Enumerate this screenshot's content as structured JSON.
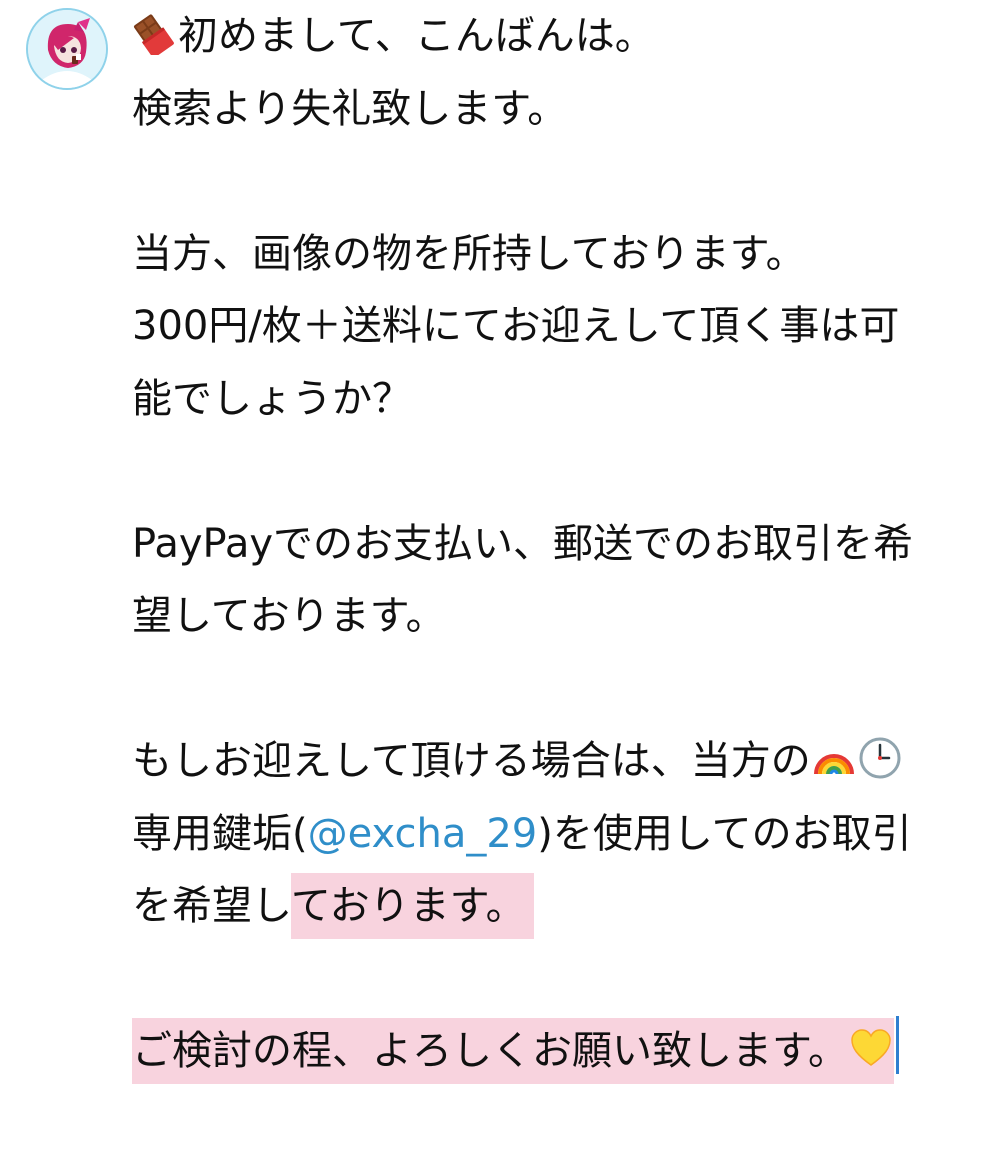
{
  "avatar": {
    "icon": "user-avatar-icon"
  },
  "message": {
    "line1_emoji": "chocolate-bar-icon",
    "line1_text": "初めまして、こんばんは。",
    "line2": "検索より失礼致します。",
    "line3": "当方、画像の物を所持しております。",
    "line4": "300円/枚＋送料にてお迎えして頂く事は可",
    "line5": "能でしょうか？",
    "line6": "PayPayでのお支払い、郵送でのお取引を希",
    "line7": "望しております。",
    "line8_text": "もしお迎えして頂ける場合は、当方の",
    "line8_emoji1": "rainbow-icon",
    "line8_emoji2": "clock-icon",
    "line9_prefix": "専用鍵垢(",
    "line9_mention": "@excha_29",
    "line9_suffix": ")を使用してのお取引",
    "line10_plain": "を希望し",
    "line10_highlight": "ております。",
    "line11_text": "ご検討の程、よろしくお願い致します。",
    "line11_emoji": "yellow-heart-icon"
  },
  "colors": {
    "mention": "#2f8ec9",
    "highlight": "#f8d3de",
    "caret": "#2f7fd0"
  }
}
